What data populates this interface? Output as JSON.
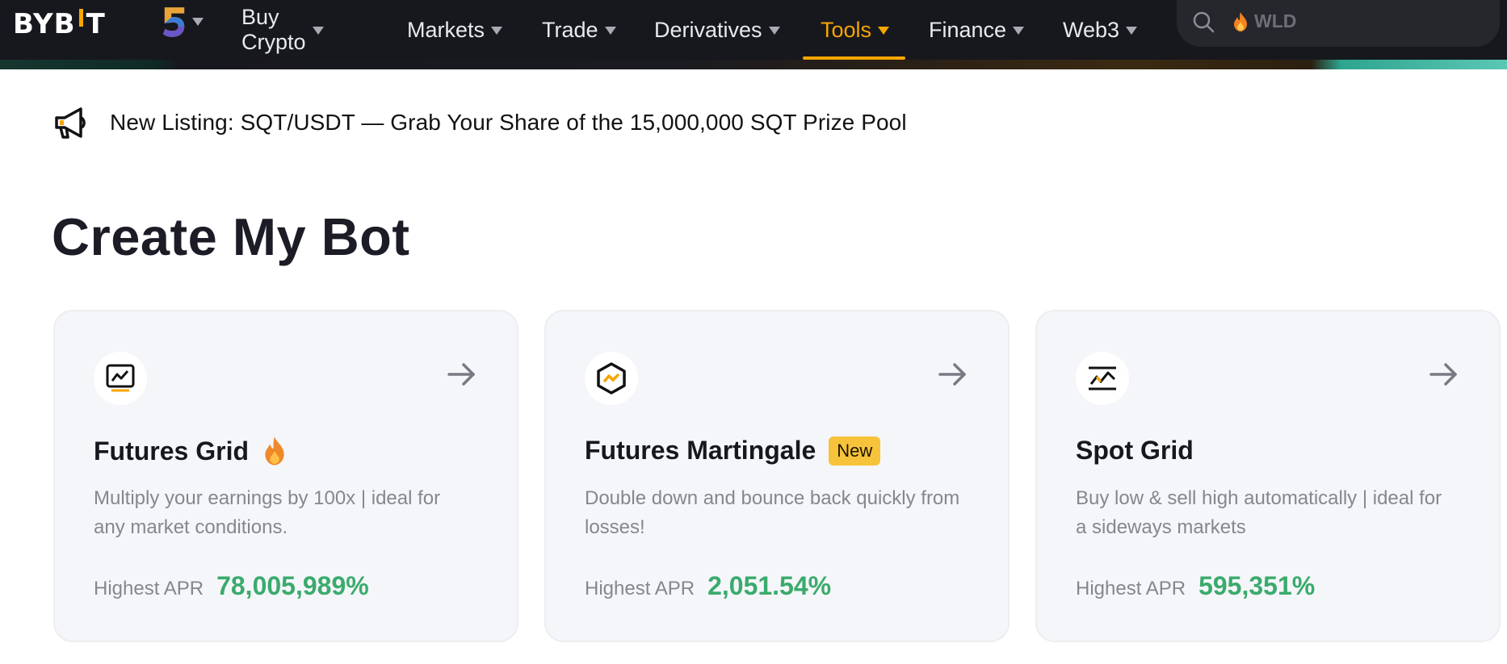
{
  "header": {
    "logo_text": "BYBIT",
    "anniversary_badge": "5",
    "nav": [
      {
        "label": "Buy Crypto",
        "active": false
      },
      {
        "label": "Markets",
        "active": false
      },
      {
        "label": "Trade",
        "active": false
      },
      {
        "label": "Derivatives",
        "active": false
      },
      {
        "label": "Tools",
        "active": true
      },
      {
        "label": "Finance",
        "active": false
      },
      {
        "label": "Web3",
        "active": false
      }
    ],
    "search": {
      "placeholder": "WLD",
      "icon": "search-icon",
      "hot_icon": "fire-icon"
    }
  },
  "announcement": {
    "icon": "megaphone-icon",
    "text": "New Listing: SQT/USDT — Grab Your Share of the 15,000,000 SQT Prize Pool"
  },
  "main": {
    "title": "Create My Bot",
    "bots": [
      {
        "name": "Futures Grid",
        "tag_icon": "fire-icon",
        "badge": "",
        "description": "Multiply your earnings by 100x | ideal for any market conditions.",
        "apr_label": "Highest APR",
        "apr_value": "78,005,989%",
        "icon": "futures-grid-icon"
      },
      {
        "name": "Futures Martingale",
        "tag_icon": "",
        "badge": "New",
        "description": "Double down and bounce back quickly from losses!",
        "apr_label": "Highest APR",
        "apr_value": "2,051.54%",
        "icon": "futures-martingale-icon"
      },
      {
        "name": "Spot Grid",
        "tag_icon": "",
        "badge": "",
        "description": "Buy low & sell high automatically | ideal for a sideways markets",
        "apr_label": "Highest APR",
        "apr_value": "595,351%",
        "icon": "spot-grid-icon"
      }
    ]
  },
  "colors": {
    "nav_bg": "#17181e",
    "accent": "#f7a600",
    "apr_green": "#3aab6d",
    "badge_yellow": "#f7c33a",
    "card_bg": "#f5f6f9"
  }
}
